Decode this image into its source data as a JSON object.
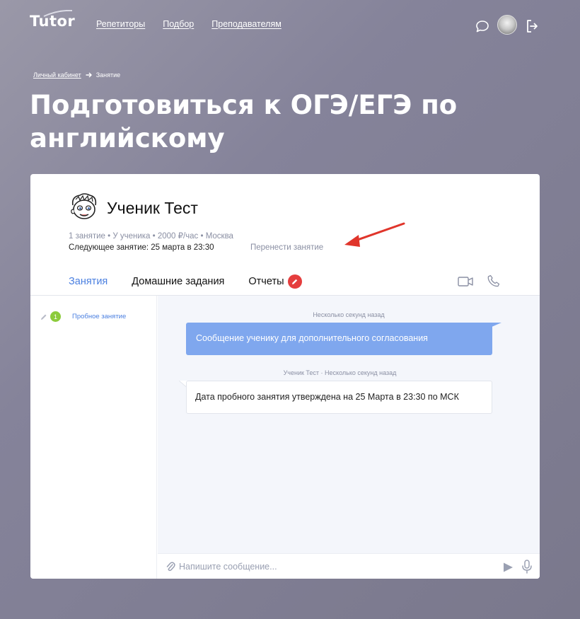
{
  "header": {
    "logo": "Tutor",
    "nav": [
      "Репетиторы",
      "Подбор",
      "Преподавателям"
    ],
    "icons": [
      "chat-icon",
      "user-avatar",
      "logout-icon"
    ]
  },
  "breadcrumb": {
    "parent": "Личный кабинет",
    "separator_icon": "arrow-right-icon",
    "current": "Занятие"
  },
  "page_title": "Подготовиться к ОГЭ/ЕГЭ по английскому",
  "student": {
    "name": "Ученик Тест",
    "meta": "1 занятие • У ученика • 2000 ₽/час • Москва",
    "next_lesson": "Следующее занятие: 25 марта в 23:30",
    "reschedule_label": "Перенести занятие"
  },
  "tabs": [
    {
      "label": "Занятия",
      "active": true
    },
    {
      "label": "Домашние задания",
      "active": false
    },
    {
      "label": "Отчеты",
      "active": false,
      "badge_icon": "pencil-icon"
    }
  ],
  "call_icons": [
    "video-camera-icon",
    "phone-icon"
  ],
  "sidebar": {
    "lessons": [
      {
        "number": "1",
        "label": "Пробное занятие",
        "status_color": "#8ccb3c"
      }
    ]
  },
  "chat": {
    "messages": [
      {
        "direction": "out",
        "timestamp": "Несколько секунд назад",
        "text": "Сообщение ученику для дополнительного согласования"
      },
      {
        "direction": "in",
        "timestamp": "Ученик Тест · Несколько секунд назад",
        "text": "Дата пробного занятия утверждена на 25 Марта в 23:30 по МСК"
      }
    ],
    "composer_placeholder": "Напишите сообщение..."
  },
  "colors": {
    "accent": "#4a7fe0",
    "outgoing_bubble": "#7fa7ee",
    "badge_red": "#e53d3d",
    "badge_green": "#8ccb3c",
    "annotation_arrow": "#e0352b"
  }
}
